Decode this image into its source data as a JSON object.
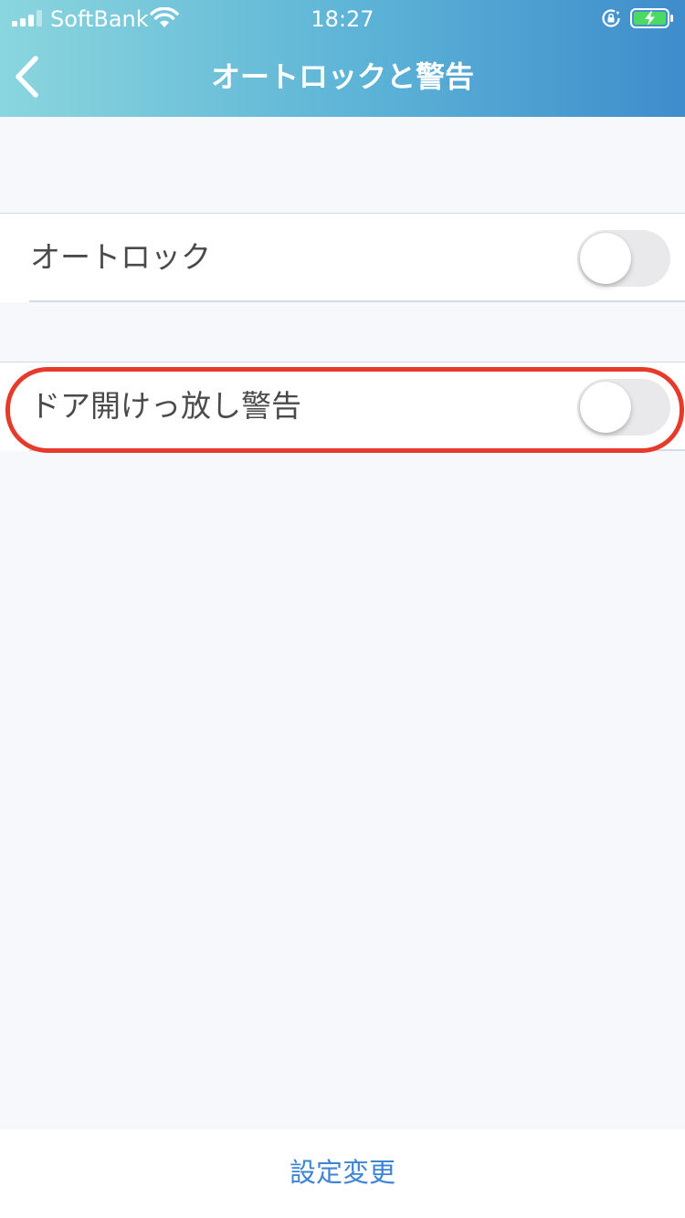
{
  "status_bar": {
    "carrier": "SoftBank",
    "time": "18:27",
    "icons": [
      "signal-icon",
      "wifi-icon",
      "rotation-lock-icon",
      "battery-charging-icon"
    ]
  },
  "nav": {
    "title": "オートロックと警告",
    "back_icon": "chevron-left-icon"
  },
  "settings": {
    "auto_lock": {
      "label": "オートロック",
      "enabled": false
    },
    "door_open_warning": {
      "label": "ドア開けっ放し警告",
      "enabled": false,
      "highlighted": true
    }
  },
  "footer": {
    "button_label": "設定変更"
  },
  "colors": {
    "header_gradient_start": "#8ad6de",
    "header_gradient_end": "#3f8ccc",
    "highlight": "#e63a2a",
    "link": "#3d83d6"
  }
}
